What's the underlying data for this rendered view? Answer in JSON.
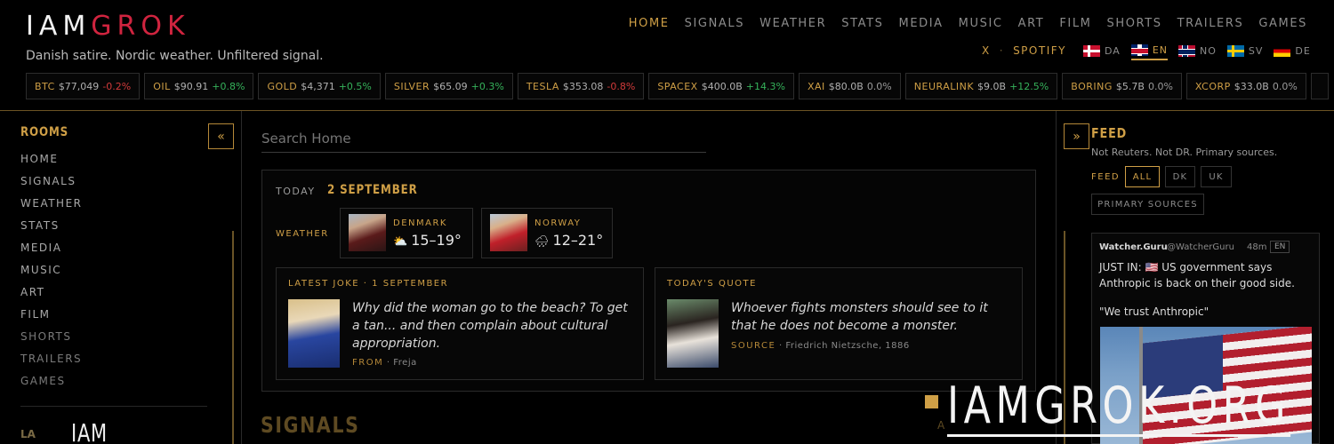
{
  "logo": {
    "part1": "IAM",
    "part2": "GROK"
  },
  "tagline": "Danish satire. Nordic weather. Unfiltered signal.",
  "nav": [
    "HOME",
    "SIGNALS",
    "WEATHER",
    "STATS",
    "MEDIA",
    "MUSIC",
    "ART",
    "FILM",
    "SHORTS",
    "TRAILERS",
    "GAMES"
  ],
  "nav_active": "HOME",
  "social": {
    "x": "X",
    "spotify": "SPOTIFY"
  },
  "languages": [
    {
      "code": "DA",
      "flag": "flag-denmark-icon"
    },
    {
      "code": "EN",
      "flag": "flag-uk-icon",
      "active": true
    },
    {
      "code": "NO",
      "flag": "flag-norway-icon"
    },
    {
      "code": "SV",
      "flag": "flag-sweden-icon"
    },
    {
      "code": "DE",
      "flag": "flag-germany-icon"
    }
  ],
  "tickers": [
    {
      "symbol": "BTC",
      "price": "$77,049",
      "change": "-0.2%",
      "dir": "down"
    },
    {
      "symbol": "OIL",
      "price": "$90.91",
      "change": "+0.8%",
      "dir": "up"
    },
    {
      "symbol": "GOLD",
      "price": "$4,371",
      "change": "+0.5%",
      "dir": "up"
    },
    {
      "symbol": "SILVER",
      "price": "$65.09",
      "change": "+0.3%",
      "dir": "up"
    },
    {
      "symbol": "TESLA",
      "price": "$353.08",
      "change": "-0.8%",
      "dir": "down"
    },
    {
      "symbol": "SPACEX",
      "price": "$400.0B",
      "change": "+14.3%",
      "dir": "up"
    },
    {
      "symbol": "XAI",
      "price": "$80.0B",
      "change": "0.0%",
      "dir": "flat"
    },
    {
      "symbol": "NEURALINK",
      "price": "$9.0B",
      "change": "+12.5%",
      "dir": "up"
    },
    {
      "symbol": "BORING",
      "price": "$5.7B",
      "change": "0.0%",
      "dir": "flat"
    },
    {
      "symbol": "XCORP",
      "price": "$33.0B",
      "change": "0.0%",
      "dir": "flat"
    }
  ],
  "sidebar": {
    "title": "ROOMS",
    "collapse_icon": "«",
    "rooms": [
      "HOME",
      "SIGNALS",
      "WEATHER",
      "STATS",
      "MEDIA",
      "MUSIC",
      "ART",
      "FILM",
      "SHORTS",
      "TRAILERS",
      "GAMES"
    ],
    "footer_label": "LA",
    "footer_logo": "IAM"
  },
  "main": {
    "search_placeholder": "Search Home",
    "today_label": "TODAY",
    "today_date": "2 SEPTEMBER",
    "weather_label": "WEATHER",
    "weather": [
      {
        "country": "DENMARK",
        "icon": "⛅",
        "temp": "15–19°"
      },
      {
        "country": "NORWAY",
        "icon": "🌧",
        "temp": "12–21°"
      }
    ],
    "joke": {
      "label": "LATEST JOKE · 1 SEPTEMBER",
      "text": "Why did the woman go to the beach? To get a tan... and then complain about cultural appropriation.",
      "from_key": "FROM",
      "from_value": "Freja"
    },
    "quote": {
      "label": "TODAY'S QUOTE",
      "text": "Whoever fights monsters should see to it that he does not become a monster.",
      "source_key": "SOURCE",
      "source_value": "Friedrich Nietzsche, 1886"
    },
    "signals_title": "SIGNALS",
    "signals_partial": "A"
  },
  "feed": {
    "expand_icon": "»",
    "title": "FEED",
    "subtitle": "Not Reuters. Not DR. Primary sources.",
    "filter_label": "FEED",
    "filters": [
      "ALL",
      "DK",
      "UK"
    ],
    "active_filter": "ALL",
    "primary_sources": "PRIMARY SOURCES",
    "post": {
      "author": "Watcher.Guru",
      "handle": "@WatcherGuru",
      "age": "48m",
      "lang": "EN",
      "body": "JUST IN: 🇺🇸 US government says Anthropic is back on their good side.",
      "quote": "\"We trust Anthropic\""
    }
  },
  "watermark": "IAMGROK.ORG",
  "colors": {
    "accent": "#cf9f46",
    "brand_red": "#d0243f",
    "up": "#35b15a",
    "down": "#d03a3a",
    "background": "#000000"
  }
}
